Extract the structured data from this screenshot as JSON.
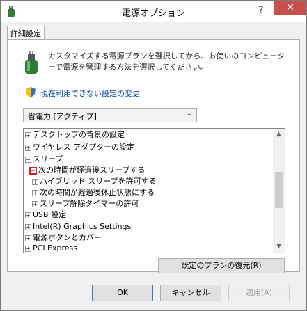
{
  "window": {
    "title": "電源オプション",
    "help_label": "?",
    "close_label": "✕"
  },
  "tab": {
    "label": "詳細設定"
  },
  "description": "カスタマイズする電源プランを選択してから、お使いのコンピューターで電源を管理する方法を選択してください。",
  "change_link": "現在利用できない設定の変更",
  "plan_select": {
    "value": "省電力 [アクティブ]"
  },
  "tree": {
    "items": [
      {
        "expander": "+",
        "label": "デスクトップの背景の設定"
      },
      {
        "expander": "+",
        "label": "ワイヤレス アダプターの設定"
      },
      {
        "expander": "−",
        "label": "スリープ"
      },
      {
        "expander": "+",
        "label": "次の時間が経過後スリープする",
        "highlighted": true
      },
      {
        "expander": "+",
        "label": "ハイブリッド スリープを許可する"
      },
      {
        "expander": "+",
        "label": "次の時間が経過後休止状態にする"
      },
      {
        "expander": "+",
        "label": "スリープ解除タイマーの許可"
      },
      {
        "expander": "+",
        "label": "USB 設定"
      },
      {
        "expander": "+",
        "label": "Intel(R) Graphics Settings"
      },
      {
        "expander": "+",
        "label": "電源ボタンとカバー"
      },
      {
        "expander": "+",
        "label": "PCI Express"
      }
    ]
  },
  "buttons": {
    "restore": "既定のプランの復元(R)",
    "ok": "OK",
    "cancel": "キャンセル",
    "apply": "適用(A)"
  },
  "colors": {
    "highlight_box": "#e02020",
    "close_button": "#c7504b",
    "link": "#0645ad"
  },
  "icons": [
    "power-plan-icon",
    "shield-icon",
    "chevron-down-icon",
    "close-icon",
    "help-icon"
  ]
}
